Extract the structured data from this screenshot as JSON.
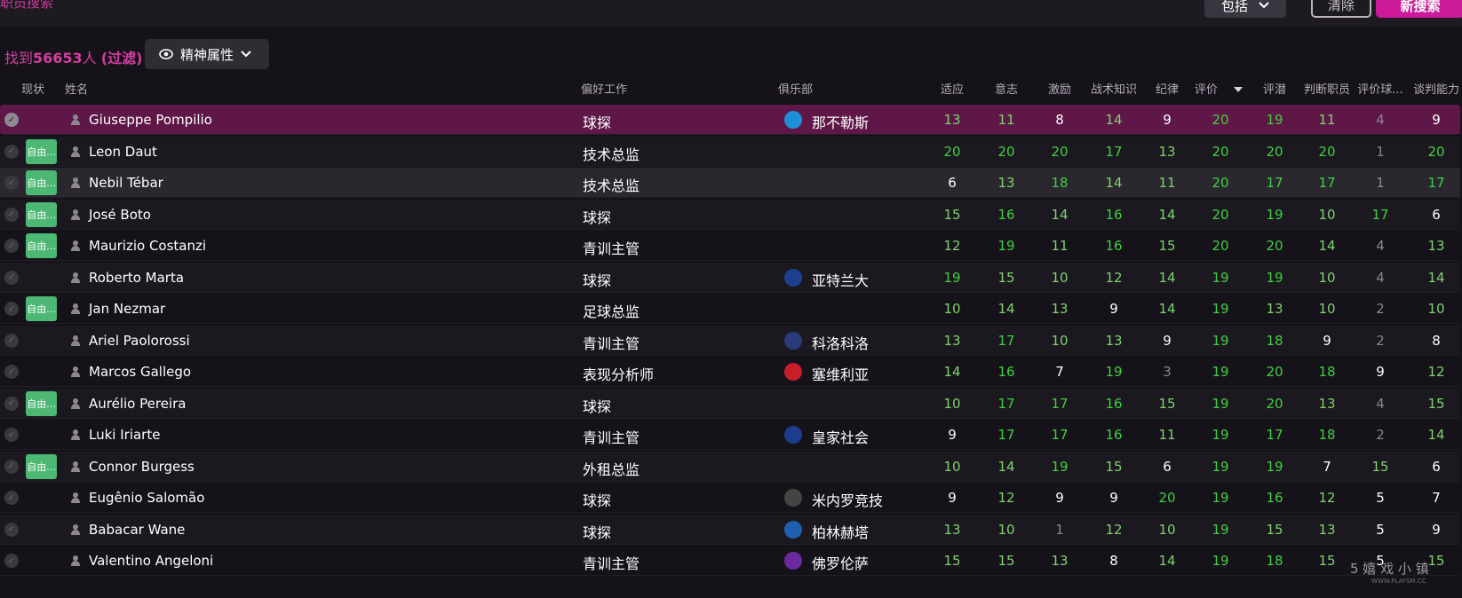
{
  "top": {
    "title": "职员搜索",
    "include_label": "包括",
    "clear_label": "清除",
    "new_search_label": "新搜索"
  },
  "summary": {
    "prefix": "找到",
    "count": "56653",
    "suffix": "人",
    "filter_note": "(过滤)",
    "view_label": "精神属性"
  },
  "columns": {
    "status": "现状",
    "name": "姓名",
    "job": "偏好工作",
    "club": "俱乐部",
    "adaptability": "适应",
    "determination": "意志",
    "motivating": "激励",
    "tactical": "战术知识",
    "discipline": "纪律",
    "judging_ability": "评价",
    "judging_potential": "评潜",
    "judging_staff": "判断职员",
    "judging_players": "评价球...",
    "negotiating": "谈判能力"
  },
  "colors": {
    "accent": "#cc1a9a",
    "selected_row": "#5e1747",
    "free_badge": "#4db774",
    "green_value": "#3ed13e"
  },
  "free_label": "自由...",
  "rows": [
    {
      "name": "Giuseppe Pompilio",
      "job": "球探",
      "club": "那不勒斯",
      "crest": "#1e8fd8",
      "free": false,
      "vals": [
        13,
        11,
        8,
        14,
        9,
        20,
        19,
        11,
        4,
        9
      ]
    },
    {
      "name": "Leon Daut",
      "job": "技术总监",
      "club": "",
      "crest": "",
      "free": true,
      "vals": [
        20,
        20,
        20,
        17,
        13,
        20,
        20,
        20,
        1,
        20
      ]
    },
    {
      "name": "Nebil Tébar",
      "job": "技术总监",
      "club": "",
      "crest": "",
      "free": true,
      "vals": [
        6,
        13,
        18,
        14,
        11,
        20,
        17,
        17,
        1,
        17
      ]
    },
    {
      "name": "José Boto",
      "job": "球探",
      "club": "",
      "crest": "",
      "free": true,
      "vals": [
        15,
        16,
        14,
        16,
        14,
        20,
        19,
        10,
        17,
        6
      ]
    },
    {
      "name": "Maurizio Costanzi",
      "job": "青训主管",
      "club": "",
      "crest": "",
      "free": true,
      "vals": [
        12,
        19,
        11,
        16,
        15,
        20,
        20,
        14,
        4,
        13
      ]
    },
    {
      "name": "Roberto Marta",
      "job": "球探",
      "club": "亚特兰大",
      "crest": "#1c3f8f",
      "free": false,
      "vals": [
        19,
        15,
        10,
        12,
        14,
        19,
        19,
        10,
        4,
        14
      ]
    },
    {
      "name": "Jan Nezmar",
      "job": "足球总监",
      "club": "",
      "crest": "",
      "free": true,
      "vals": [
        10,
        14,
        13,
        9,
        14,
        19,
        13,
        10,
        2,
        10
      ]
    },
    {
      "name": "Ariel Paolorossi",
      "job": "青训主管",
      "club": "科洛科洛",
      "crest": "#2a3a7a",
      "free": false,
      "vals": [
        13,
        17,
        10,
        13,
        9,
        19,
        18,
        9,
        2,
        8
      ]
    },
    {
      "name": "Marcos Gallego",
      "job": "表现分析师",
      "club": "塞维利亚",
      "crest": "#c81e2c",
      "free": false,
      "vals": [
        14,
        16,
        7,
        19,
        3,
        19,
        20,
        18,
        9,
        12
      ]
    },
    {
      "name": "Aurélio Pereira",
      "job": "球探",
      "club": "",
      "crest": "",
      "free": true,
      "vals": [
        10,
        17,
        17,
        16,
        15,
        19,
        20,
        13,
        4,
        15
      ]
    },
    {
      "name": "Luki Iriarte",
      "job": "青训主管",
      "club": "皇家社会",
      "crest": "#1a3e8c",
      "free": false,
      "vals": [
        9,
        17,
        17,
        16,
        11,
        19,
        17,
        18,
        2,
        14
      ]
    },
    {
      "name": "Connor Burgess",
      "job": "外租总监",
      "club": "",
      "crest": "",
      "free": true,
      "vals": [
        10,
        14,
        19,
        15,
        6,
        19,
        19,
        7,
        15,
        6
      ]
    },
    {
      "name": "Eugênio Salomão",
      "job": "球探",
      "club": "米内罗竞技",
      "crest": "#444444",
      "free": false,
      "vals": [
        9,
        12,
        9,
        9,
        20,
        19,
        16,
        12,
        5,
        7
      ]
    },
    {
      "name": "Babacar Wane",
      "job": "球探",
      "club": "柏林赫塔",
      "crest": "#1f5fb0",
      "free": false,
      "vals": [
        13,
        10,
        1,
        12,
        10,
        19,
        15,
        13,
        5,
        9
      ]
    },
    {
      "name": "Valentino Angeloni",
      "job": "青训主管",
      "club": "佛罗伦萨",
      "crest": "#6b2aa0",
      "free": false,
      "vals": [
        15,
        15,
        13,
        8,
        14,
        19,
        18,
        15,
        5,
        15
      ]
    }
  ]
}
